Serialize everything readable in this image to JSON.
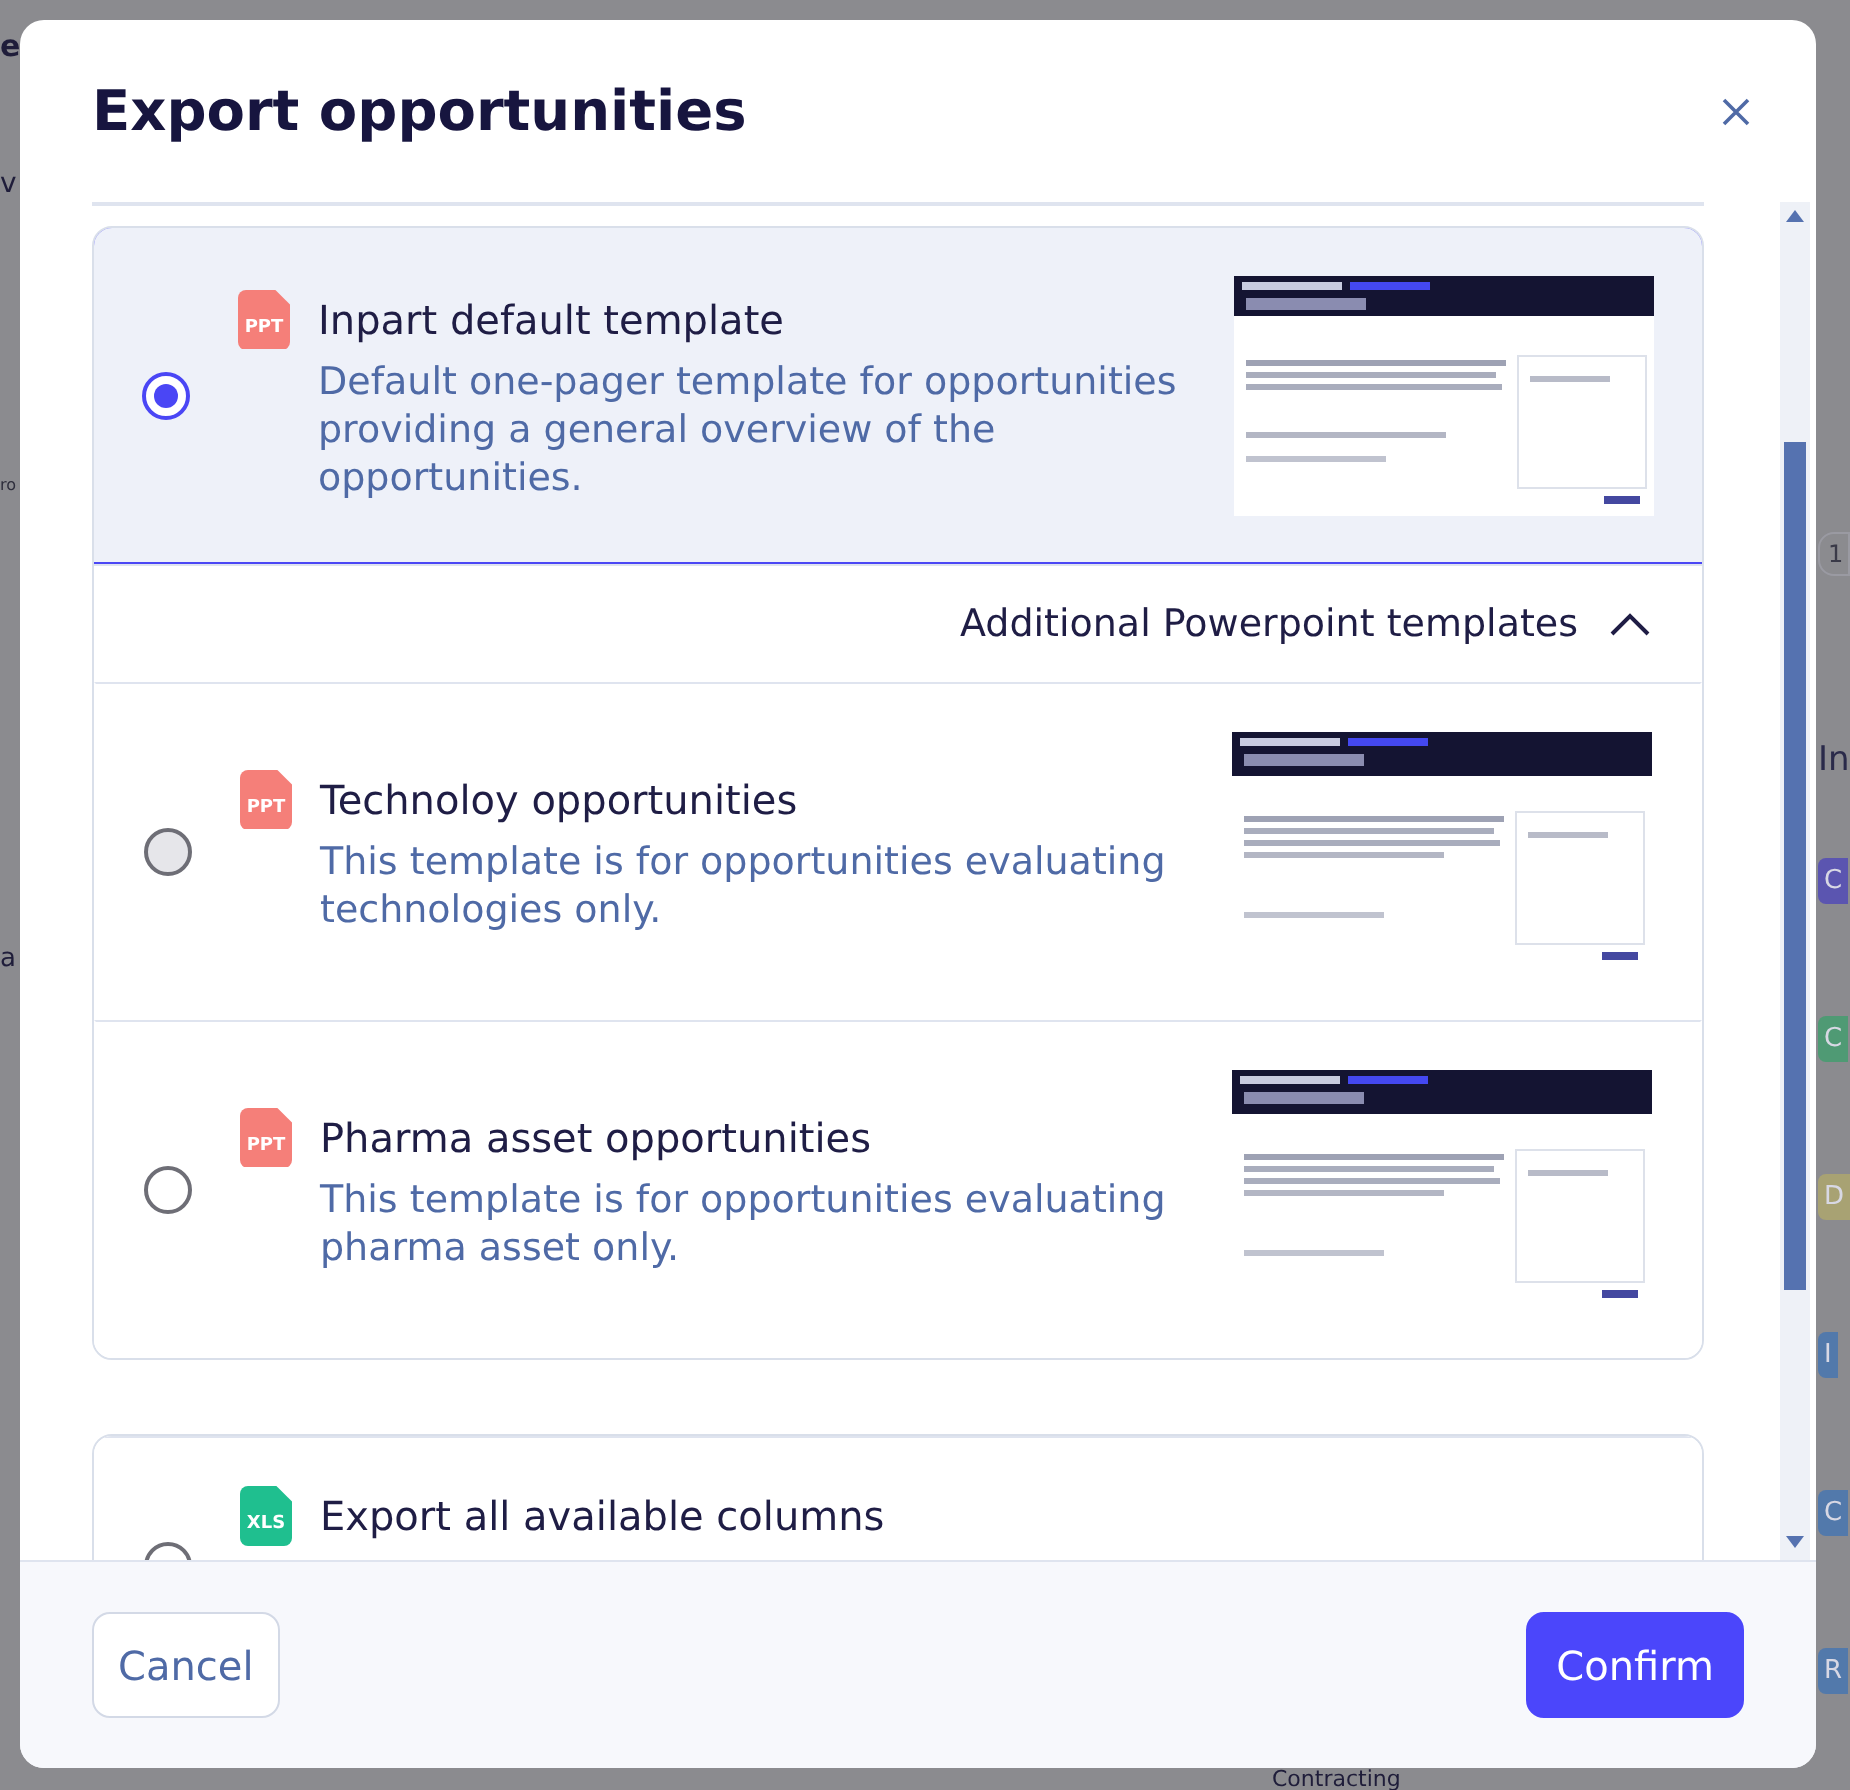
{
  "background": {
    "left_fragments": [
      {
        "text": "e",
        "kind": "title"
      },
      {
        "text": "v",
        "kind": "tab"
      },
      {
        "text": "ro",
        "kind": "placeholder"
      },
      {
        "text": "a",
        "kind": "cell"
      }
    ],
    "right_fragments": [
      {
        "text": "1",
        "kind": "pill"
      },
      {
        "text": "In",
        "kind": "heading"
      },
      {
        "text": "C",
        "kind": "badge",
        "color": "#5b55b0"
      },
      {
        "text": "C",
        "kind": "badge",
        "color": "#4f9a74"
      },
      {
        "text": "D",
        "kind": "badge",
        "color": "#a8a273"
      },
      {
        "text": "I",
        "kind": "badge",
        "color": "#5279ab"
      },
      {
        "text": "C",
        "kind": "badge",
        "color": "#5279ab"
      },
      {
        "text": "R",
        "kind": "badge",
        "color": "#5279ab"
      }
    ],
    "bottom_fragment": "Contracting"
  },
  "dialog": {
    "title": "Export opportunities",
    "template_card": {
      "primary": {
        "kind": "ppt",
        "file_type": "PPT",
        "label": "Inpart default template",
        "description": "Default one-pager template for opportunities providing a general overview of the opportunities.",
        "selected": true
      },
      "expander": {
        "label": "Additional Powerpoint templates",
        "expanded": true
      },
      "more": [
        {
          "kind": "ppt",
          "file_type": "PPT",
          "label": "Technoloy opportunities",
          "description": "This template is for opportunities evaluating technologies only.",
          "selected": false
        },
        {
          "kind": "ppt",
          "file_type": "PPT",
          "label": "Pharma asset opportunities",
          "description": "This template is for opportunities evaluating pharma asset only.",
          "selected": false
        }
      ]
    },
    "export_card": {
      "options": [
        {
          "kind": "xls",
          "file_type": "XLS",
          "label": "Export all available columns",
          "selected": false
        }
      ]
    },
    "buttons": {
      "cancel": "Cancel",
      "confirm": "Confirm"
    }
  }
}
